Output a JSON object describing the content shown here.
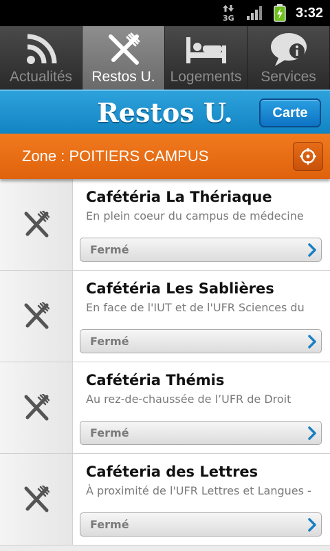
{
  "statusbar": {
    "time": "3:32",
    "network": "3G",
    "icons": [
      "data-arrows-icon",
      "signal-icon",
      "battery-charging-icon"
    ]
  },
  "tabs": [
    {
      "label": "Actualités",
      "icon": "rss-icon",
      "active": false
    },
    {
      "label": "Restos U.",
      "icon": "fork-knife-icon",
      "active": true
    },
    {
      "label": "Logements",
      "icon": "bed-icon",
      "active": false
    },
    {
      "label": "Services",
      "icon": "info-bubble-icon",
      "active": false
    }
  ],
  "header": {
    "title": "Restos U.",
    "map_button": "Carte"
  },
  "zone": {
    "label": "Zone : POITIERS CAMPUS",
    "locate_icon": "locate-icon"
  },
  "restaurants": [
    {
      "name": "Cafétéria La Thériaque",
      "description": "En plein coeur du campus de médecine",
      "status": "Fermé"
    },
    {
      "name": "Cafétéria Les Sablières",
      "description": "En face de l'IUT et de l'UFR Sciences du",
      "status": "Fermé"
    },
    {
      "name": "Cafétéria Thémis",
      "description": "Au rez-de-chaussée de l’UFR de Droit",
      "status": "Fermé"
    },
    {
      "name": "Caféteria des Lettres",
      "description": "À proximité de l'UFR Lettres et Langues -",
      "status": "Fermé"
    }
  ],
  "colors": {
    "accent_blue": "#1a8fd0",
    "accent_orange": "#e8680f",
    "status_arrow": "#1a7fc4"
  }
}
